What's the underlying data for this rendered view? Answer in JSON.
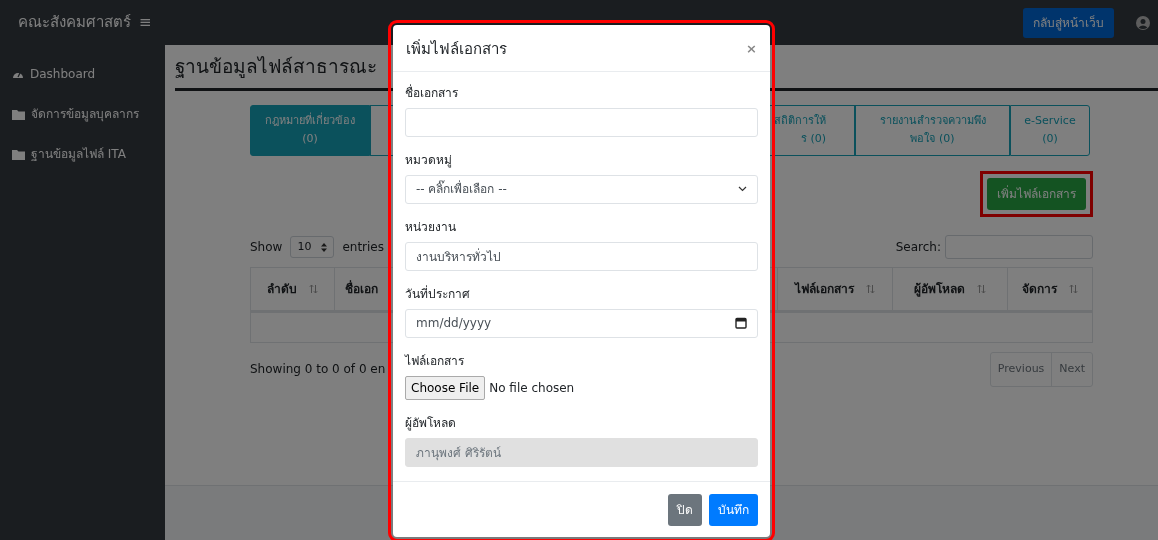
{
  "navbar": {
    "brand": "คณะสังคมศาสตร์",
    "menu_glyph": "≡",
    "back_button": "กลับสู่หน้าเว็บ"
  },
  "sidebar": {
    "items": [
      {
        "label": "Dashboard",
        "kind": "dashboard"
      },
      {
        "label": "จัดการข้อมูลบุคลากร",
        "kind": "folder"
      },
      {
        "label": "ฐานข้อมูลไฟล์ ITA",
        "kind": "folder"
      }
    ]
  },
  "page_title": "ฐานข้อมูลไฟล์สาธารณะ",
  "tabs": [
    {
      "lines": [
        "กฎหมายที่เกี่ยวข้อง",
        "(0)"
      ],
      "selected": true,
      "kind": "full"
    },
    {
      "lines": [
        "สถิติการให้",
        "ร (0)"
      ],
      "selected": false,
      "kind": "partial"
    },
    {
      "lines": [
        "รายงานสำรวจความพึง",
        "พอใจ (0)"
      ],
      "selected": false,
      "kind": "full"
    },
    {
      "lines": [
        "e-Service",
        "(0)"
      ],
      "selected": false,
      "kind": "full"
    }
  ],
  "add_button": {
    "label": "เพิ่มไฟล์เอกสาร",
    "highlighted": true
  },
  "length_control": {
    "before": "Show",
    "value": "10",
    "after": "entries"
  },
  "search": {
    "label": "Search:"
  },
  "table": {
    "columns": [
      {
        "label": "ลำดับ",
        "kind": "narrow"
      },
      {
        "label": "ชื่อเอก",
        "kind": "wide"
      },
      {
        "label": "ไฟล์เอกสาร",
        "kind": "normal"
      },
      {
        "label": "ผู้อัพโหลด",
        "kind": "normal"
      },
      {
        "label": "จัดการ",
        "kind": "narrow"
      }
    ]
  },
  "info": "Showing 0 to 0 of 0 en",
  "pagination": [
    "Previous",
    "Next"
  ],
  "modal": {
    "title": "เพิ่มไฟล์เอกสาร",
    "close": "×",
    "highlighted": true,
    "fields": [
      {
        "kind": "text",
        "label": "ชื่อเอกสาร"
      },
      {
        "kind": "select",
        "label": "หมวดหมู่",
        "value": "-- คลิ๊กเพื่อเลือก --"
      },
      {
        "kind": "text",
        "label": "หน่วยงาน",
        "value": "งานบริหารทั่วไป"
      },
      {
        "kind": "date",
        "label": "วันที่ประกาศ",
        "placeholder": "mm/dd/yyyy"
      },
      {
        "kind": "file",
        "label": "ไฟล์เอกสาร",
        "button": "Choose File",
        "status": "No file chosen"
      },
      {
        "kind": "text",
        "label": "ผู้อัพโหลด",
        "value": "ภานุพงศ์ ศิริรัตน์",
        "disabled": true
      }
    ],
    "buttons": [
      {
        "label": "ปิด",
        "kind": "secondary"
      },
      {
        "label": "บันทึก",
        "kind": "primary"
      }
    ]
  }
}
